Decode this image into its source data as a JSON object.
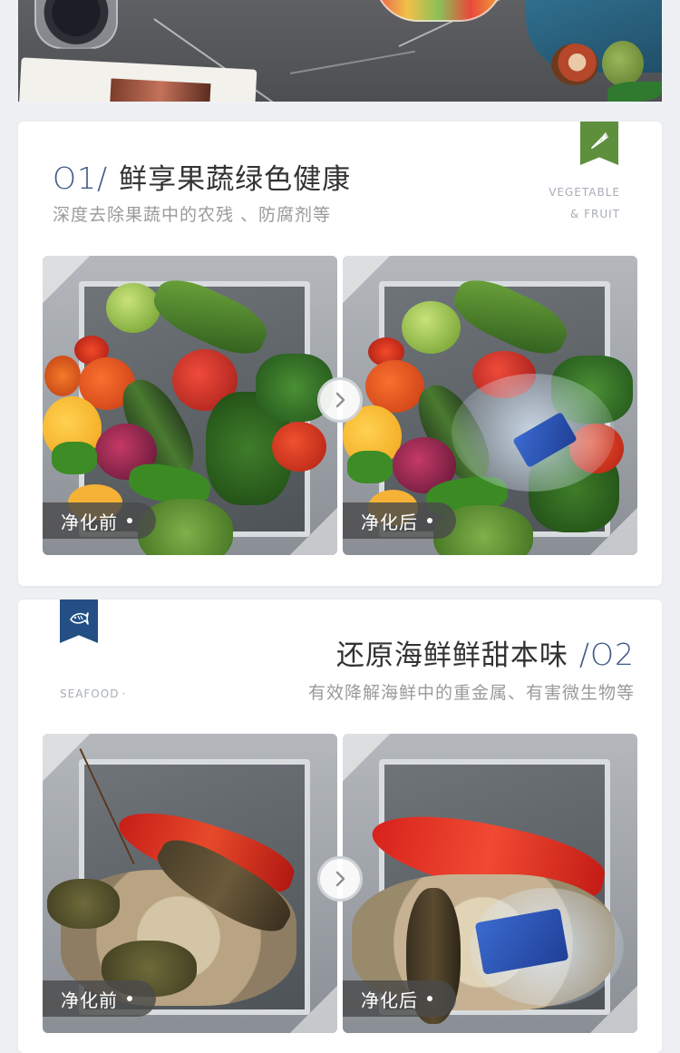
{
  "section1": {
    "number": "O1/",
    "title": "鲜享果蔬绿色健康",
    "subtitle": "深度去除果蔬中的农残 、防腐剂等",
    "english_line1": "VEGETABLE",
    "english_line2": "& FRUIT",
    "tag_icon": "carrot-icon",
    "tag_color": "#5d8f3d",
    "before_label": "净化前",
    "after_label": "净化后"
  },
  "section2": {
    "number": "/O2",
    "title": "还原海鲜鲜甜本味",
    "subtitle": "有效降解海鲜中的重金属、有害微生物等",
    "english": "SEAFOOD",
    "tag_icon": "fish-icon",
    "tag_color": "#234f84",
    "before_label": "净化前",
    "after_label": "净化后"
  },
  "colors": {
    "accent_blue": "#3f5a86",
    "badge_bg": "#4b4b4b"
  }
}
